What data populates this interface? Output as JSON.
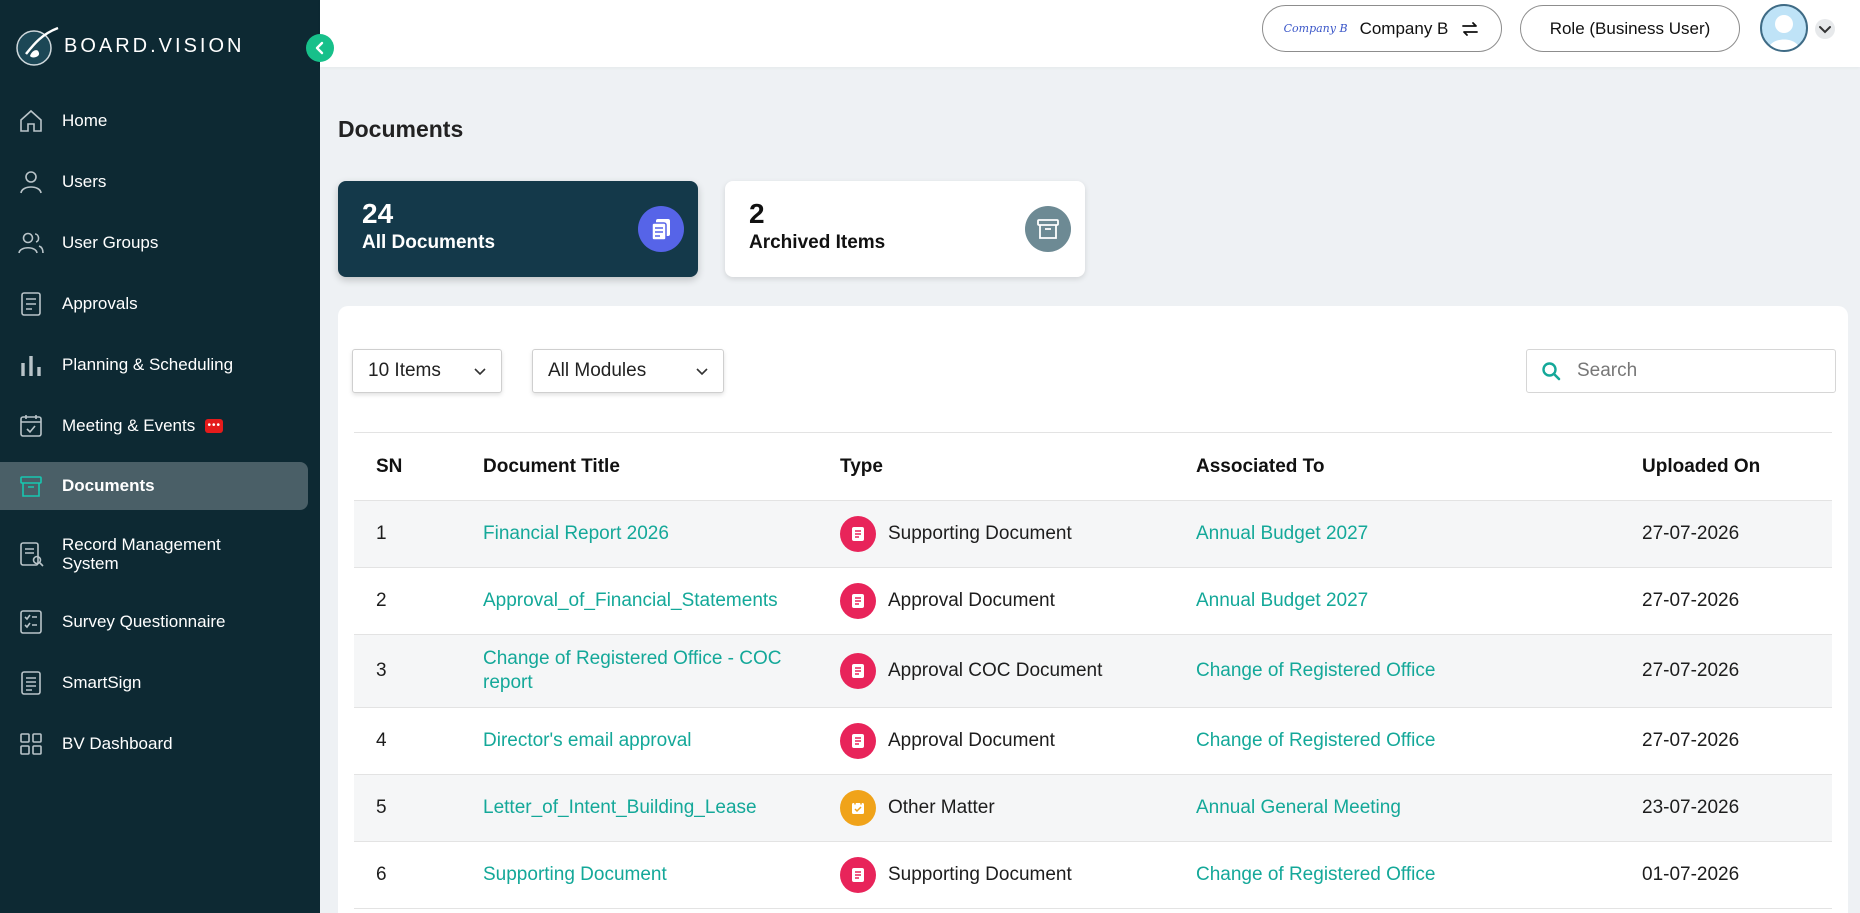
{
  "brand": {
    "name": "BOARD.VISION"
  },
  "sidebar": {
    "items": [
      {
        "label": "Home",
        "icon": "home-icon"
      },
      {
        "label": "Users",
        "icon": "user-icon"
      },
      {
        "label": "User Groups",
        "icon": "user-group-icon"
      },
      {
        "label": "Approvals",
        "icon": "approvals-icon"
      },
      {
        "label": "Planning & Scheduling",
        "icon": "bar-chart-icon"
      },
      {
        "label": "Meeting & Events",
        "icon": "calendar-check-icon",
        "badge": "chat-badge"
      },
      {
        "label": "Documents",
        "icon": "archive-box-icon",
        "active": true
      },
      {
        "label": "Record Management System",
        "icon": "record-search-icon"
      },
      {
        "label": "Survey Questionnaire",
        "icon": "survey-icon"
      },
      {
        "label": "SmartSign",
        "icon": "document-icon"
      },
      {
        "label": "BV Dashboard",
        "icon": "grid-icon"
      }
    ]
  },
  "header": {
    "company_logo_text": "Company B",
    "company_label": "Company B",
    "role_label": "Role (Business User)"
  },
  "page": {
    "title": "Documents",
    "cards": {
      "all": {
        "count": "24",
        "label": "All Documents"
      },
      "archived": {
        "count": "2",
        "label": "Archived Items"
      }
    }
  },
  "filters": {
    "items_per_page": "10 Items",
    "module": "All Modules",
    "search_placeholder": "Search"
  },
  "table": {
    "headers": {
      "sn": "SN",
      "title": "Document Title",
      "type": "Type",
      "assoc": "Associated To",
      "date": "Uploaded On"
    },
    "rows": [
      {
        "sn": "1",
        "title": "Financial Report 2026",
        "type": "Supporting Document",
        "type_icon": "document-icon",
        "assoc": "Annual Budget 2027",
        "date": "27-07-2026"
      },
      {
        "sn": "2",
        "title": "Approval_of_Financial_Statements",
        "type": "Approval Document",
        "type_icon": "document-icon",
        "assoc": "Annual Budget 2027",
        "date": "27-07-2026"
      },
      {
        "sn": "3",
        "title": "Change of Registered Office - COC report",
        "type": "Approval COC Document",
        "type_icon": "document-icon",
        "assoc": "Change of Registered Office",
        "date": "27-07-2026"
      },
      {
        "sn": "4",
        "title": "Director's email approval",
        "type": "Approval Document",
        "type_icon": "document-icon",
        "assoc": "Change of Registered Office",
        "date": "27-07-2026"
      },
      {
        "sn": "5",
        "title": "Letter_of_Intent_Building_Lease",
        "type": "Other Matter",
        "type_icon": "calendar-check-icon",
        "assoc": "Annual General Meeting",
        "date": "23-07-2026"
      },
      {
        "sn": "6",
        "title": "Supporting Document",
        "type": "Supporting Document",
        "type_icon": "document-icon",
        "assoc": "Change of Registered Office",
        "date": "01-07-2026"
      }
    ]
  },
  "colors": {
    "sidebar_bg": "#0d2933",
    "accent_teal": "#14a899",
    "active_card": "#14394a",
    "doc_type_icon": "#e8245a",
    "other_type_icon": "#f0a31a"
  }
}
